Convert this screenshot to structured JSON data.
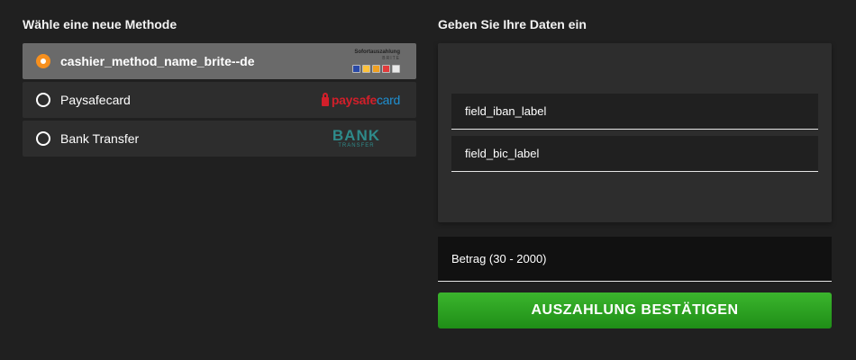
{
  "left": {
    "title": "Wähle eine neue Methode",
    "methods": [
      {
        "label": "cashier_method_name_brite--de",
        "selected": true,
        "logo": "brite-logo",
        "logo_text_top": "Sofortauszahlung",
        "logo_text_brand": "BRITE"
      },
      {
        "label": "Paysafecard",
        "selected": false,
        "logo": "paysafecard-logo",
        "logo_text_a": "paysafe",
        "logo_text_b": "card"
      },
      {
        "label": "Bank Transfer",
        "selected": false,
        "logo": "bank-transfer-logo",
        "logo_text_big": "BANK",
        "logo_text_small": "TRANSFER"
      }
    ]
  },
  "right": {
    "title": "Geben Sie Ihre Daten ein",
    "fields": {
      "iban_label": "field_iban_label",
      "bic_label": "field_bic_label"
    },
    "amount_label": "Betrag (30 - 2000)",
    "confirm_label": "AUSZAHLUNG BESTÄTIGEN"
  },
  "colors": {
    "background": "#202020",
    "selected_radio": "#f7901e",
    "confirm_green": "#2ea322"
  }
}
